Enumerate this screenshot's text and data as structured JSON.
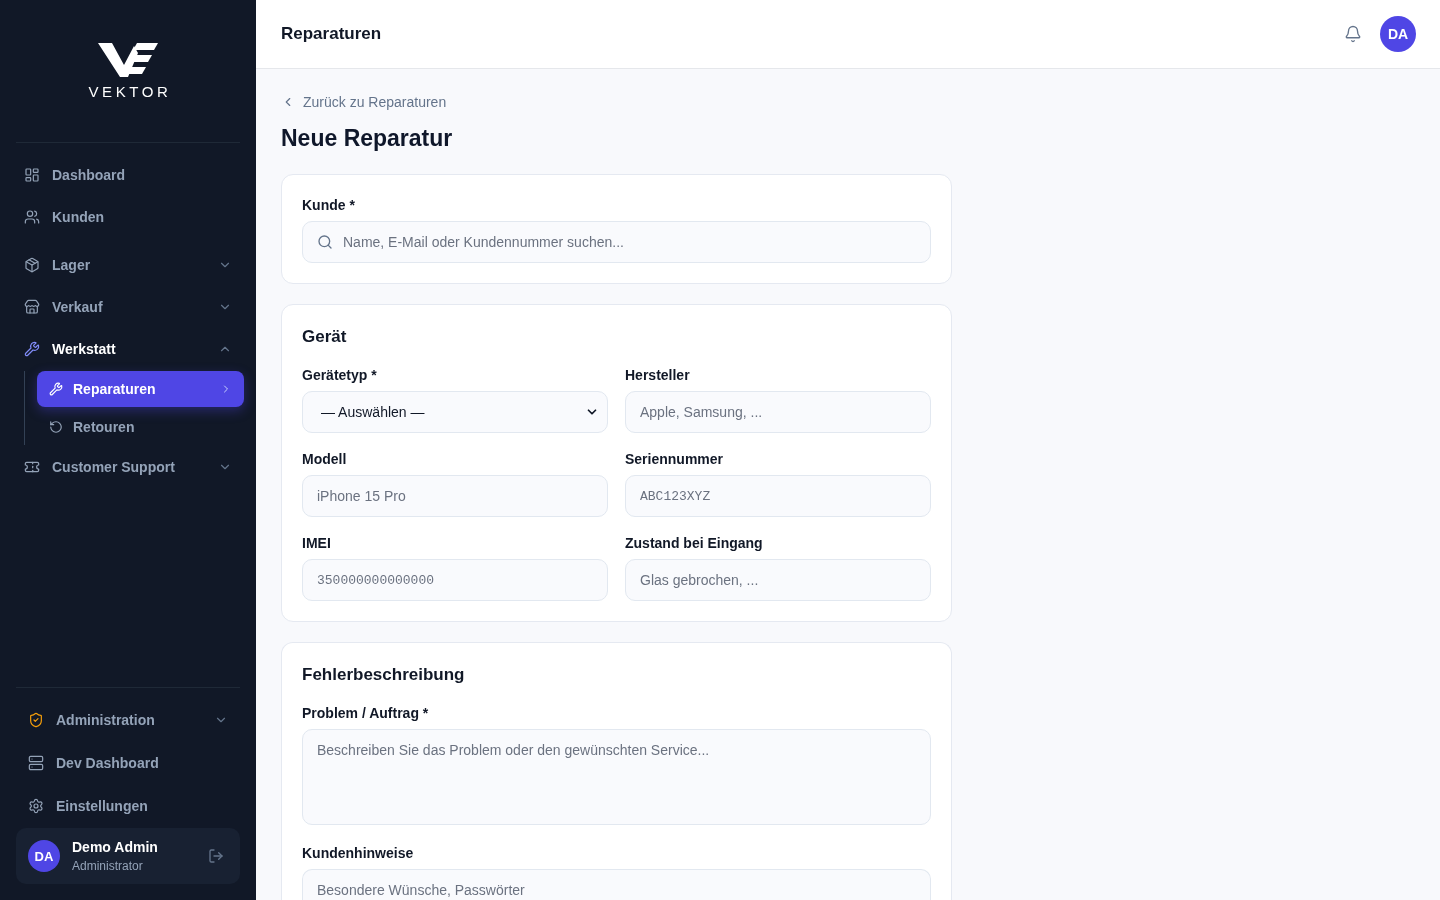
{
  "sidebar": {
    "logo": {
      "wordmark": "VEKTOR"
    },
    "nav": [
      {
        "label": "Dashboard",
        "kind": "link",
        "selected": false
      },
      {
        "label": "Kunden",
        "kind": "link",
        "selected": false
      },
      {
        "label": "Lager",
        "kind": "group",
        "selected": false,
        "expanded": false
      },
      {
        "label": "Verkauf",
        "kind": "group",
        "selected": false,
        "expanded": false
      },
      {
        "label": "Werkstatt",
        "kind": "group",
        "selected": true,
        "expanded": true,
        "children": [
          {
            "label": "Reparaturen",
            "selected": true
          },
          {
            "label": "Retouren",
            "selected": false
          }
        ]
      },
      {
        "label": "Customer Support",
        "kind": "group",
        "selected": false,
        "expanded": false
      }
    ],
    "bottom_nav": [
      {
        "label": "Administration",
        "kind": "group",
        "selected": false,
        "expanded": false
      },
      {
        "label": "Dev Dashboard",
        "kind": "link",
        "selected": false
      },
      {
        "label": "Einstellungen",
        "kind": "link",
        "selected": false
      }
    ],
    "user": {
      "initials": "DA",
      "name": "Demo Admin",
      "role": "Administrator"
    }
  },
  "header": {
    "title": "Reparaturen",
    "avatar_initials": "DA"
  },
  "back_link": "Zurück zu Reparaturen",
  "page_title": "Neue Reparatur",
  "sections": [
    {
      "kind": "stack",
      "fields": [
        {
          "label": "Kunde *",
          "kind": "search",
          "placeholder": "Name, E-Mail oder Kundennummer suchen..."
        }
      ]
    },
    {
      "kind": "grid",
      "title": "Gerät",
      "fields": [
        {
          "label": "Gerätetyp *",
          "kind": "select",
          "value": "— Auswählen —"
        },
        {
          "label": "Hersteller",
          "kind": "text",
          "placeholder": "Apple, Samsung, ..."
        },
        {
          "label": "Modell",
          "kind": "text",
          "placeholder": "iPhone 15 Pro"
        },
        {
          "label": "Seriennummer",
          "kind": "mono",
          "placeholder": "ABC123XYZ"
        },
        {
          "label": "IMEI",
          "kind": "mono",
          "placeholder": "350000000000000"
        },
        {
          "label": "Zustand bei Eingang",
          "kind": "text",
          "placeholder": "Glas gebrochen, ..."
        }
      ]
    },
    {
      "kind": "stack",
      "title": "Fehlerbeschreibung",
      "fields": [
        {
          "label": "Problem / Auftrag *",
          "kind": "textarea",
          "placeholder": "Beschreiben Sie das Problem oder den gewünschten Service..."
        },
        {
          "label": "Kundenhinweise",
          "kind": "textarea",
          "placeholder": "Besondere Wünsche, Passwörter"
        }
      ]
    }
  ]
}
